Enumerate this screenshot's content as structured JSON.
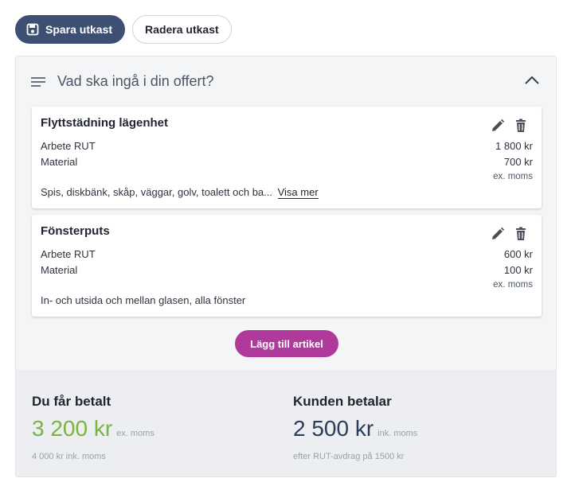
{
  "toolbar": {
    "save_label": "Spara utkast",
    "delete_label": "Radera utkast"
  },
  "panel": {
    "title": "Vad ska ingå i din offert?"
  },
  "items": [
    {
      "title": "Flyttstädning lägenhet",
      "rows": [
        {
          "label": "Arbete RUT",
          "value": "1 800 kr"
        },
        {
          "label": "Material",
          "value": "700 kr"
        }
      ],
      "vat_note": "ex. moms",
      "description": "Spis, diskbänk, skåp, väggar, golv, toalett och ba...",
      "more_label": "Visa mer"
    },
    {
      "title": "Fönsterputs",
      "rows": [
        {
          "label": "Arbete RUT",
          "value": "600 kr"
        },
        {
          "label": "Material",
          "value": "100 kr"
        }
      ],
      "vat_note": "ex. moms",
      "description": "In- och utsida och mellan glasen, alla fönster"
    }
  ],
  "add_item_label": "Lägg till artikel",
  "summary": {
    "you_get": {
      "heading": "Du får betalt",
      "amount": "3 200 kr",
      "unit": "ex. moms",
      "note": "4 000 kr ink. moms"
    },
    "customer_pays": {
      "heading": "Kunden betalar",
      "amount": "2 500 kr",
      "unit": "ink. moms",
      "note": "efter RUT-avdrag på 1500 kr"
    }
  },
  "icons": {
    "save": "floppy-disk-icon",
    "menu": "lines-icon",
    "collapse": "chevron-up-icon",
    "edit": "pencil-icon",
    "delete": "trash-icon"
  },
  "colors": {
    "primary_button": "#3d4f72",
    "add_button": "#b03a9c",
    "amount_green": "#7bb342",
    "amount_navy": "#2e3c5a"
  }
}
